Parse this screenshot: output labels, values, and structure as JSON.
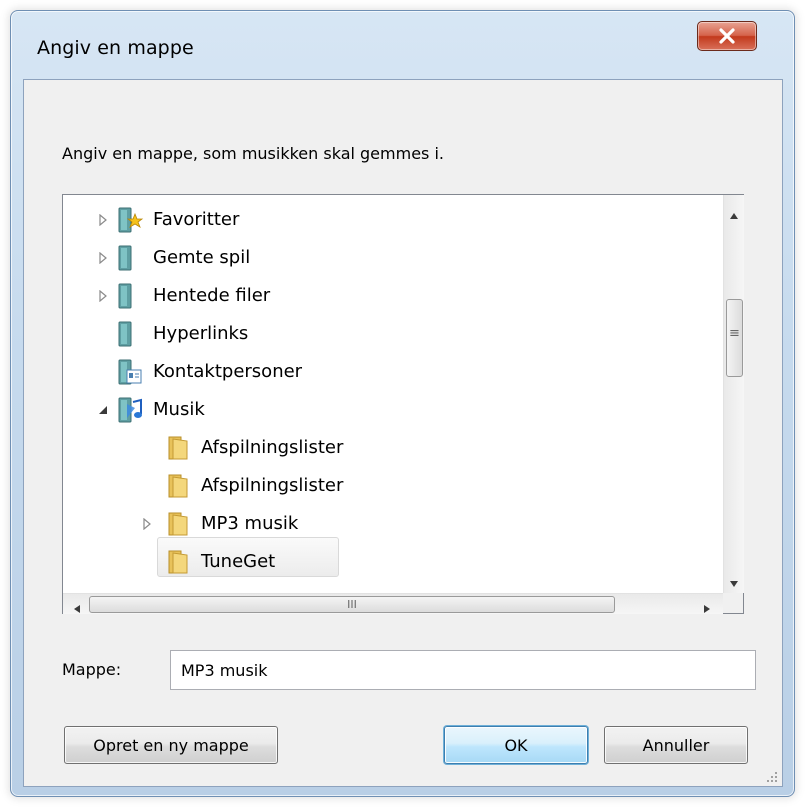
{
  "window": {
    "title": "Angiv en mappe",
    "close_icon": "close-icon"
  },
  "prompt": "Angiv en mappe, som musikken skal gemmes i.",
  "tree": {
    "items": [
      {
        "label": "Favoritter",
        "icon": "favorites-folder-icon",
        "expander": "collapsed"
      },
      {
        "label": "Gemte spil",
        "icon": "saved-games-folder-icon",
        "expander": "collapsed"
      },
      {
        "label": "Hentede filer",
        "icon": "downloads-folder-icon",
        "expander": "collapsed"
      },
      {
        "label": "Hyperlinks",
        "icon": "links-folder-icon",
        "expander": "none"
      },
      {
        "label": "Kontaktpersoner",
        "icon": "contacts-folder-icon",
        "expander": "none"
      },
      {
        "label": "Musik",
        "icon": "music-folder-icon",
        "expander": "expanded"
      },
      {
        "label": "Afspilningslister",
        "icon": "folder-icon",
        "expander": "none"
      },
      {
        "label": "Afspilningslister",
        "icon": "folder-icon",
        "expander": "none"
      },
      {
        "label": "MP3 musik",
        "icon": "folder-icon",
        "expander": "collapsed",
        "selected": true
      },
      {
        "label": "TuneGet",
        "icon": "folder-icon",
        "expander": "none"
      }
    ],
    "scrollbar_grip_glyph": "≡",
    "hscroll_grip_glyph": "III"
  },
  "folder_field": {
    "label": "Mappe:",
    "value": "MP3 musik"
  },
  "buttons": {
    "new_folder": "Opret en ny mappe",
    "ok": "OK",
    "cancel": "Annuller"
  },
  "colors": {
    "title_bar": "#c7dbee",
    "close_button": "#c2391c",
    "default_button": "#bee6fd",
    "folder": "#e8c25a"
  }
}
